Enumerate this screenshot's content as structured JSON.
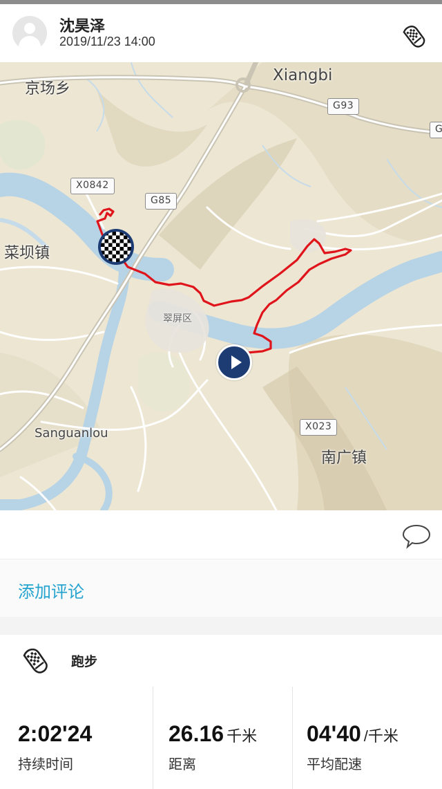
{
  "header": {
    "user_name": "沈昊泽",
    "timestamp": "2019/11/23 14:00",
    "avatar_icon": "user-avatar-icon",
    "activity_icon": "running-shoe-icon"
  },
  "map": {
    "labels": {
      "xiangbi": "Xiangbi",
      "jingchang": "京场乡",
      "caiba": "菜坝镇",
      "cuiping": "翠屏区",
      "sanguanlou": "Sanguanlou",
      "nanguang": "南广镇"
    },
    "shields": {
      "g93": "G93",
      "x0842": "X0842",
      "g85": "G85",
      "x023": "X023",
      "g_edge": "G"
    },
    "route_color": "#e0141b",
    "start_icon": "checkered-flag-icon",
    "end_icon": "play-icon"
  },
  "actions": {
    "comment_icon": "speech-bubble-icon"
  },
  "add_comment_label": "添加评论",
  "activity": {
    "type": "跑步",
    "icon": "running-shoe-icon",
    "stats": {
      "duration": {
        "value": "2:02'24",
        "unit": "",
        "label": "持续时间"
      },
      "distance": {
        "value": "26.16",
        "unit": "千米",
        "label": "距离"
      },
      "pace": {
        "value": "04'40",
        "unit": "/千米",
        "label": "平均配速"
      }
    }
  },
  "colors": {
    "accent": "#23a3ce",
    "marker": "#1d3c73",
    "route": "#e0141b"
  }
}
